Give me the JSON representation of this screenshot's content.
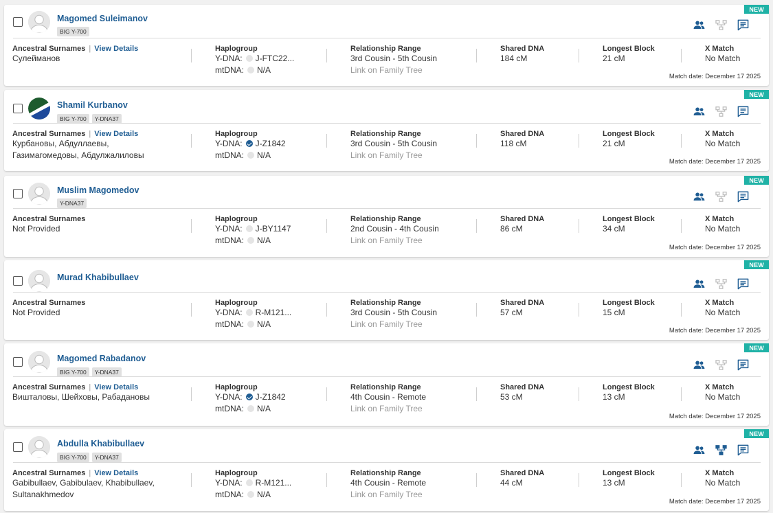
{
  "labels": {
    "new": "NEW",
    "ancestral_surnames": "Ancestral Surnames",
    "view_details": "View Details",
    "haplogroup": "Haplogroup",
    "ydna_prefix": "Y-DNA:",
    "mtdna_prefix": "mtDNA:",
    "relationship_range": "Relationship Range",
    "link_family_tree": "Link on Family Tree",
    "shared_dna": "Shared DNA",
    "longest_block": "Longest Block",
    "x_match": "X Match",
    "match_date_prefix": "Match date:"
  },
  "colors": {
    "brand_blue": "#1f5d93",
    "new_badge": "#1fb2a6",
    "inactive_icon": "#bdbdbd"
  },
  "matches": [
    {
      "name": "Magomed Suleimanov",
      "avatar": "default-avatar",
      "tags": [
        "BIG Y-700"
      ],
      "view_details": true,
      "surnames": [
        "Сулейманов"
      ],
      "ydna": "J-FTC22...",
      "ydna_verified": false,
      "mtdna": "N/A",
      "relationship": "3rd Cousin - 5th Cousin",
      "shared_dna": "184 cM",
      "longest_block": "21 cM",
      "x_match": "No Match",
      "match_date": "December 17 2025",
      "tree_icon_active": false
    },
    {
      "name": "Shamil Kurbanov",
      "avatar": "flag-avatar",
      "tags": [
        "BIG Y-700",
        "Y-DNA37"
      ],
      "view_details": true,
      "surnames": [
        "Курбановы, Абдуллаевы,",
        "Газимагомедовы, Абдулжалиловы"
      ],
      "ydna": "J-Z1842",
      "ydna_verified": true,
      "mtdna": "N/A",
      "relationship": "3rd Cousin - 5th Cousin",
      "shared_dna": "118 cM",
      "longest_block": "21 cM",
      "x_match": "No Match",
      "match_date": "December 17 2025",
      "tree_icon_active": false
    },
    {
      "name": "Muslim Magomedov",
      "avatar": "default-avatar",
      "tags": [
        "Y-DNA37"
      ],
      "view_details": false,
      "surnames": [
        "Not Provided"
      ],
      "ydna": "J-BY1147",
      "ydna_verified": false,
      "mtdna": "N/A",
      "relationship": "2nd Cousin - 4th Cousin",
      "shared_dna": "86 cM",
      "longest_block": "34 cM",
      "x_match": "No Match",
      "match_date": "December 17 2025",
      "tree_icon_active": false
    },
    {
      "name": "Murad Khabibullaev",
      "avatar": "default-avatar",
      "tags": [],
      "view_details": false,
      "surnames": [
        "Not Provided"
      ],
      "ydna": "R-M121...",
      "ydna_verified": false,
      "mtdna": "N/A",
      "relationship": "3rd Cousin - 5th Cousin",
      "shared_dna": "57 cM",
      "longest_block": "15 cM",
      "x_match": "No Match",
      "match_date": "December 17 2025",
      "tree_icon_active": false
    },
    {
      "name": "Magomed Rabadanov",
      "avatar": "default-avatar",
      "tags": [
        "BIG Y-700",
        "Y-DNA37"
      ],
      "view_details": true,
      "surnames": [
        "Вишталовы, Шейховы, Рабадановы"
      ],
      "ydna": "J-Z1842",
      "ydna_verified": true,
      "mtdna": "N/A",
      "relationship": "4th Cousin - Remote",
      "shared_dna": "53 cM",
      "longest_block": "13 cM",
      "x_match": "No Match",
      "match_date": "December 17 2025",
      "tree_icon_active": false
    },
    {
      "name": "Abdulla Khabibullaev",
      "avatar": "default-avatar",
      "tags": [
        "BIG Y-700",
        "Y-DNA37"
      ],
      "view_details": true,
      "surnames": [
        "Gabibullaev, Gabibulaev, Khabibullaev,",
        "Sultanakhmedov"
      ],
      "ydna": "R-M121...",
      "ydna_verified": false,
      "mtdna": "N/A",
      "relationship": "4th Cousin - Remote",
      "shared_dna": "44 cM",
      "longest_block": "13 cM",
      "x_match": "No Match",
      "match_date": "December 17 2025",
      "tree_icon_active": true
    }
  ]
}
